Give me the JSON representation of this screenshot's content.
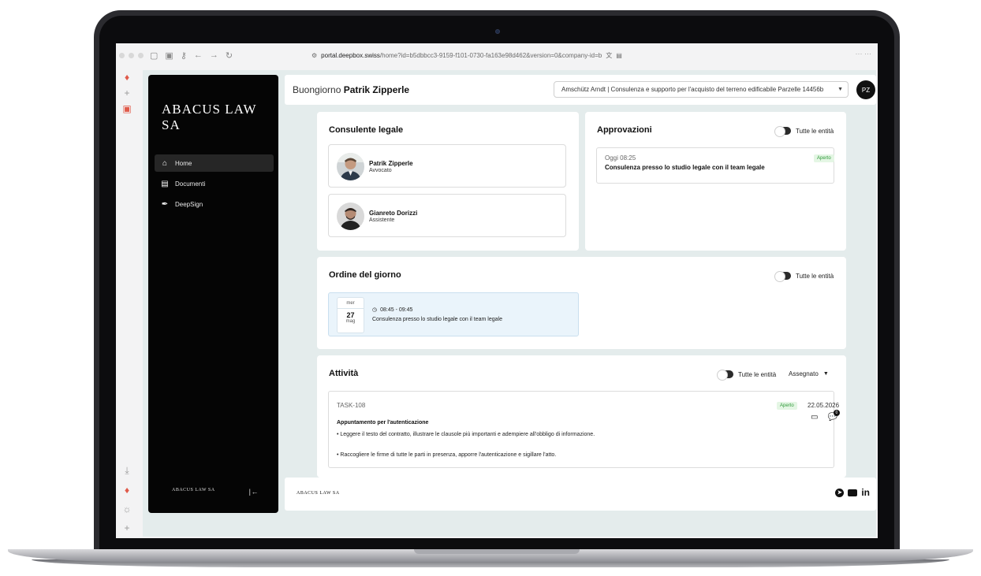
{
  "browser": {
    "url_domain": "portal.deepbox.swiss",
    "url_path": "/home?id=b5dbbcc3-9159-f101-0730-fa163e98d462&version=0&company-id=b",
    "nav_back": "←",
    "nav_forward": "→",
    "reload": "↻"
  },
  "sidebar": {
    "brand": "ABACUS LAW SA",
    "items": [
      {
        "label": "Home",
        "icon": "home-icon"
      },
      {
        "label": "Documenti",
        "icon": "archive-icon"
      },
      {
        "label": "DeepSign",
        "icon": "pen-icon"
      }
    ],
    "footer_brand": "ABACUS LAW SA",
    "collapse_glyph": "|←"
  },
  "header": {
    "greeting": "Buongiorno",
    "user_name": "Patrik Zipperle",
    "company": "Amschütz Arndt | Consulenza e supporto per l'acquisto del terreno edificabile Parzelle 14456b",
    "avatar_initials": "PZ"
  },
  "legal": {
    "title": "Consulente legale",
    "people": [
      {
        "name": "Patrik Zipperle",
        "role": "Avvocato"
      },
      {
        "name": "Gianreto Dorizzi",
        "role": "Assistente"
      }
    ]
  },
  "approvals": {
    "title": "Approvazioni",
    "toggle_label": "Tutte le entità",
    "item": {
      "time": "Oggi 08:25",
      "status": "Aperto",
      "title": "Consulenza presso lo studio legale con il team legale"
    }
  },
  "agenda": {
    "title": "Ordine del giorno",
    "toggle_label": "Tutte le entità",
    "event": {
      "weekday": "mer",
      "day": "27",
      "month": "mag",
      "time": "08:45 - 09:45",
      "desc": "Consulenza presso lo studio legale con il team legale"
    }
  },
  "activities": {
    "title": "Attività",
    "toggle_label": "Tutte le entità",
    "filter": "Assegnato",
    "task": {
      "id": "TASK-108",
      "status": "Aperto",
      "date": "22.05.2026",
      "title": "Appuntamento per l'autenticazione",
      "bullet1": "• Leggere il testo del contratto, illustrare le clausole più importanti e adempiere all'obbligo di informazione.",
      "bullet2": "• Raccogliere le firme di tutte le parti in presenza, apporre l'autenticazione e sigillare l'atto.",
      "comments_count": "0"
    }
  },
  "footer": {
    "brand": "ABACUS LAW SA",
    "social": [
      "telegram-icon",
      "youtube-icon",
      "linkedin-icon"
    ],
    "linkedin": "in"
  },
  "colors": {
    "accent_dark": "#050505",
    "app_bg": "#e4ecec",
    "status_green": "#2f9a3a",
    "agenda_bg": "#eaf4fb"
  }
}
